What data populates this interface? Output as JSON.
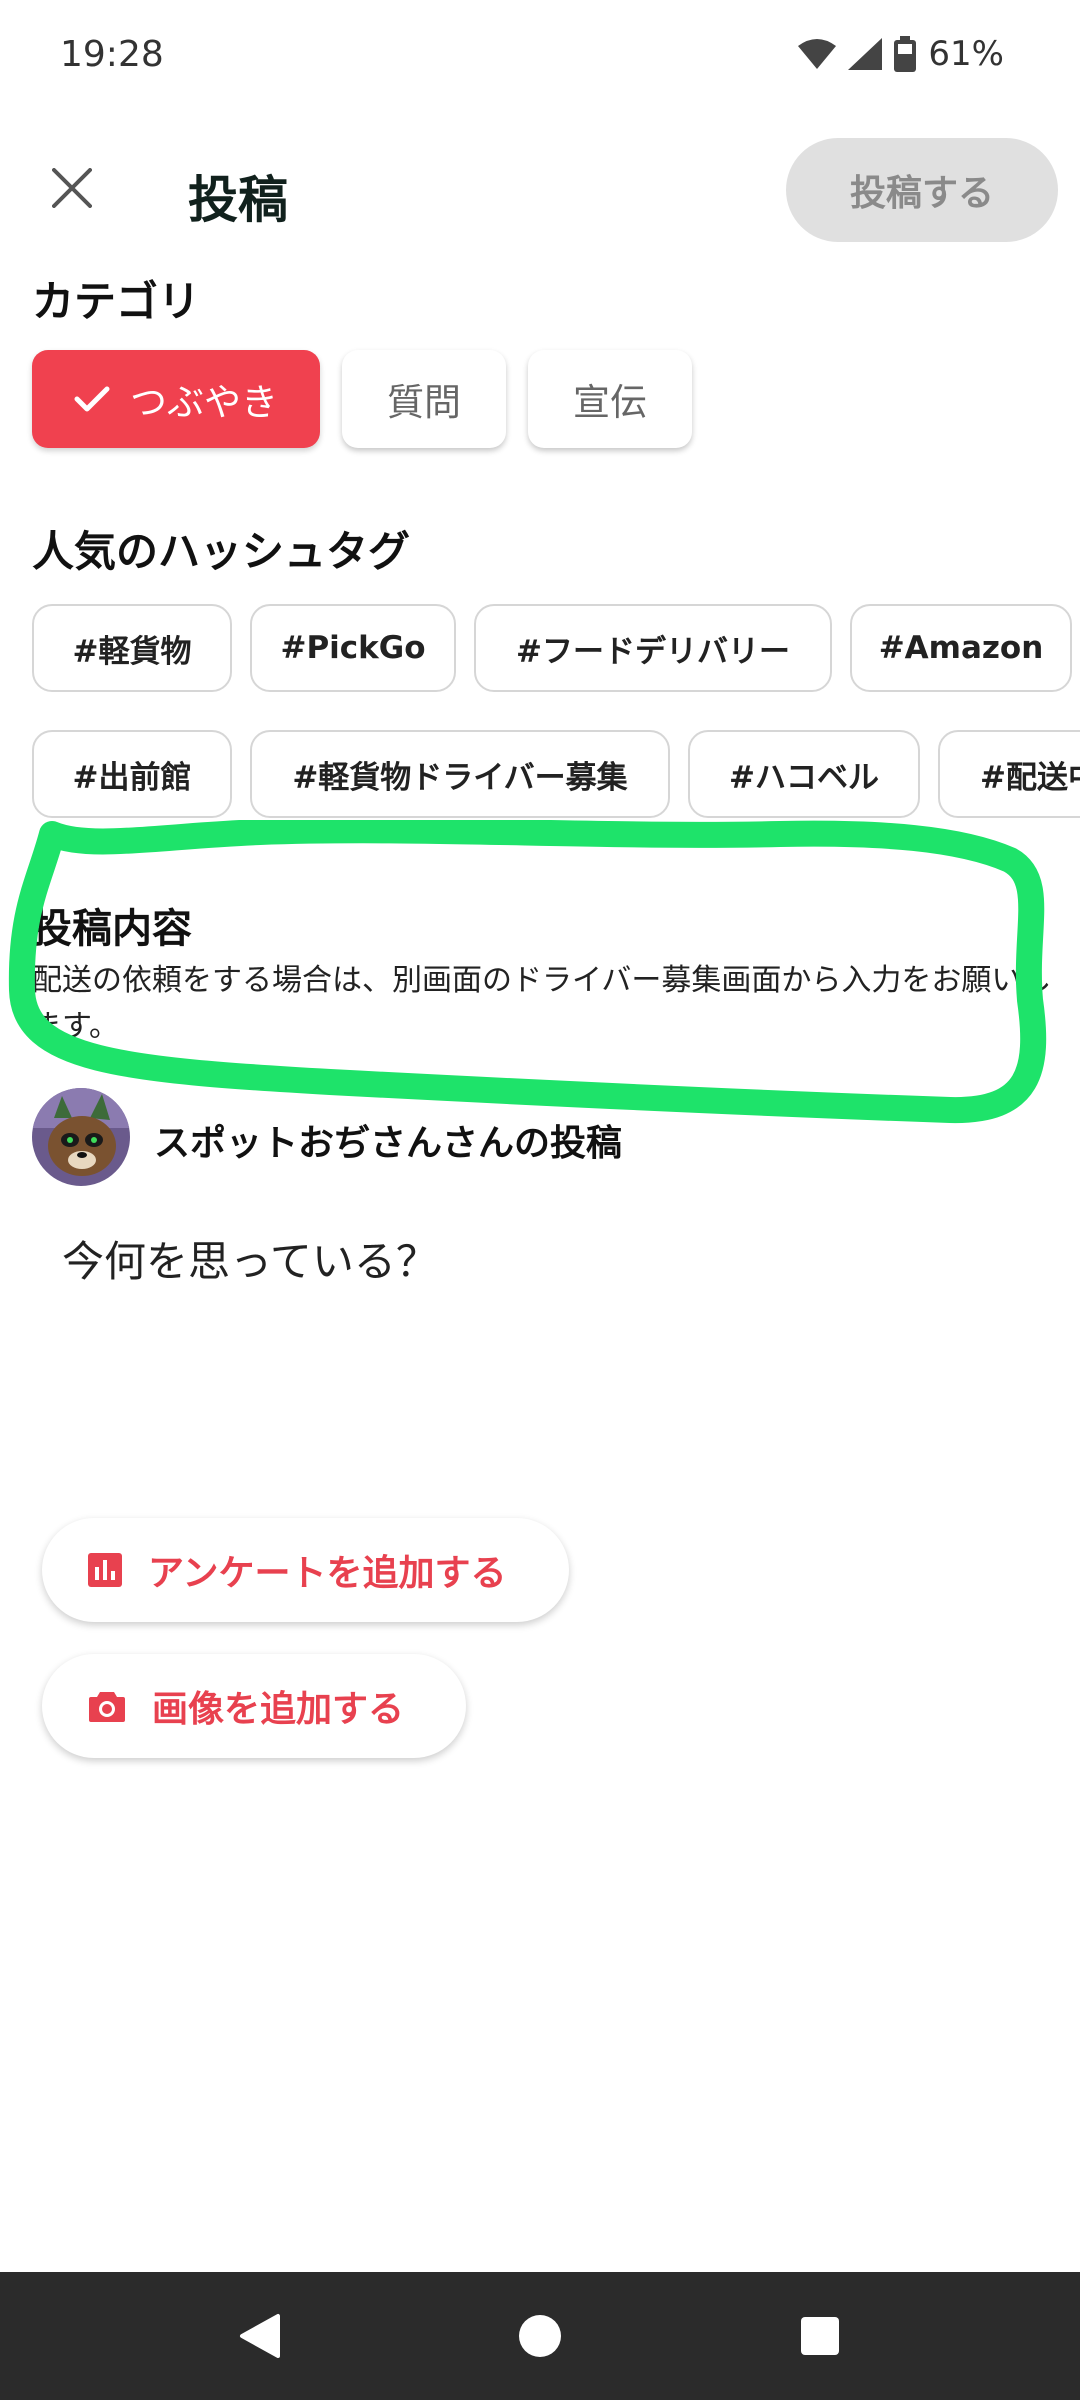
{
  "status_bar": {
    "time": "19:28",
    "battery": "61%",
    "icons": [
      "wifi-icon",
      "signal-icon",
      "battery-icon"
    ]
  },
  "header": {
    "close_icon": "close-icon",
    "title": "投稿",
    "submit_label": "投稿する"
  },
  "category": {
    "title": "カテゴリ",
    "options": [
      {
        "label": "つぶやき",
        "selected": true
      },
      {
        "label": "質問",
        "selected": false
      },
      {
        "label": "宣伝",
        "selected": false
      }
    ]
  },
  "hashtags": {
    "title": "人気のハッシュタグ",
    "row1": [
      "#軽貨物",
      "#PickGo",
      "#フードデリバリー",
      "#Amazon"
    ],
    "row2": [
      "#出前館",
      "#軽貨物ドライバー募集",
      "#ハコベル",
      "#配送中"
    ]
  },
  "content": {
    "title": "投稿内容",
    "description": "配送の依頼をする場合は、別画面のドライバー募集画面から入力をお願いします。"
  },
  "author": {
    "name": "スポットおぢさんさんの投稿"
  },
  "post": {
    "placeholder": "今何を思っている？"
  },
  "actions": {
    "add_survey": "アンケートを追加する",
    "add_image": "画像を追加する"
  },
  "colors": {
    "accent": "#f0414f",
    "action_text": "#e8414f",
    "highlight_stroke": "#1ee36a",
    "disabled_button": "#e0e0e0"
  }
}
